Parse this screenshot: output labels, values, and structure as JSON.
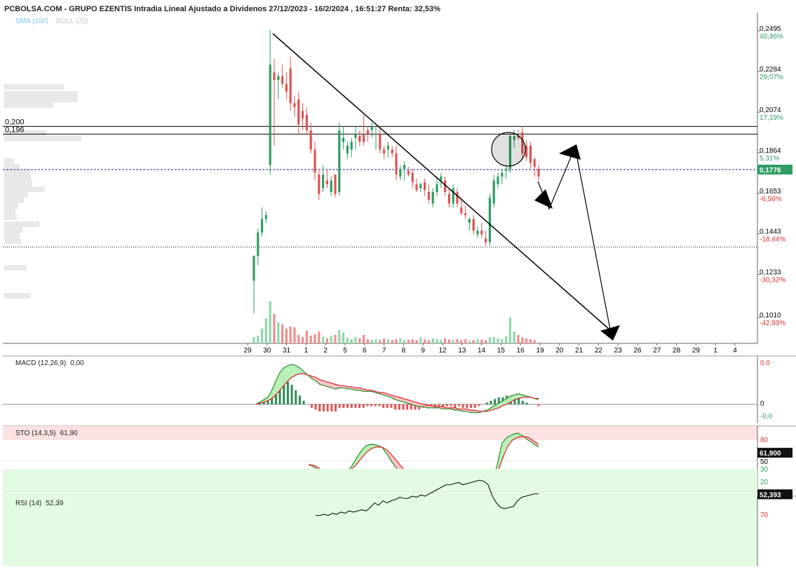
{
  "header": {
    "title": "PCBOLSA.COM - GRUPO EZENTIS Intradia Lineal Ajustado a Dividenos 27/12/2023 - 16/2/2024 , 16:51:27 Renta: 32,53%",
    "indicators_legend": [
      "SMA (100)",
      "BOLL (20)"
    ]
  },
  "colors": {
    "up": "#2e9e64",
    "down": "#e05252",
    "up_volume": "#8fd7ad",
    "down_volume": "#ef8d8d",
    "price_tag_bg": "#2e9e64",
    "axis_red": "#e03030",
    "axis_green": "#2e9e64",
    "overbought_zone": "#fde2e2",
    "oversold_zone": "#e2fbe2",
    "macd_fill_up": "#b9f0b9",
    "macd_fill_down": "#f7c5c5",
    "trendline": "#000000",
    "current_line": "#2222aa"
  },
  "chart_data": [
    {
      "type": "candlestick",
      "title": "PCBOLSA.COM - GRUPO EZENTIS Intradia Lineal Ajustado a Dividenos 27/12/2023 - 16/2/2024 , 16:51:27 Renta: 32,53%",
      "x_ticks": [
        "29",
        "30",
        "31",
        "1",
        "2",
        "5",
        "6",
        "7",
        "8",
        "9",
        "12",
        "13",
        "14",
        "15",
        "16",
        "19",
        "20",
        "21",
        "22",
        "23",
        "26",
        "27",
        "28",
        "29",
        "1",
        "4"
      ],
      "y_ticks": [
        {
          "value": 0.2495,
          "label": "0,2495",
          "pct": "40,96%"
        },
        {
          "value": 0.2284,
          "label": "0,2284",
          "pct": "29,07%"
        },
        {
          "value": 0.2074,
          "label": "0,2074",
          "pct": "17,19%"
        },
        {
          "value": 0.1864,
          "label": "0,1864",
          "pct": "5,31%"
        },
        {
          "value": 0.1653,
          "label": "0,1653",
          "pct": "-6,56%"
        },
        {
          "value": 0.1443,
          "label": "0,1443",
          "pct": "-18,44%"
        },
        {
          "value": 0.1233,
          "label": "0,1233",
          "pct": "-30,32%"
        },
        {
          "value": 0.101,
          "label": "0,1010",
          "pct": "-42,93%"
        }
      ],
      "last_price": {
        "value": 0.1776,
        "label": "0,1776"
      },
      "levels": [
        {
          "value": 0.2,
          "label": "0,200"
        },
        {
          "value": 0.196,
          "label": "0,196"
        },
        {
          "value": 0.1375,
          "label": ""
        }
      ],
      "candles": [
        {
          "o": 0.12,
          "h": 0.133,
          "l": 0.103,
          "c": 0.133
        },
        {
          "o": 0.133,
          "h": 0.147,
          "l": 0.128,
          "c": 0.145
        },
        {
          "o": 0.145,
          "h": 0.158,
          "l": 0.143,
          "c": 0.152
        },
        {
          "o": 0.152,
          "h": 0.156,
          "l": 0.15,
          "c": 0.154
        },
        {
          "o": 0.18,
          "h": 0.25,
          "l": 0.175,
          "c": 0.232
        },
        {
          "o": 0.228,
          "h": 0.235,
          "l": 0.19,
          "c": 0.224
        },
        {
          "o": 0.224,
          "h": 0.228,
          "l": 0.214,
          "c": 0.226
        },
        {
          "o": 0.226,
          "h": 0.232,
          "l": 0.22,
          "c": 0.222
        },
        {
          "o": 0.222,
          "h": 0.228,
          "l": 0.214,
          "c": 0.218
        },
        {
          "o": 0.23,
          "h": 0.236,
          "l": 0.208,
          "c": 0.212
        },
        {
          "o": 0.212,
          "h": 0.216,
          "l": 0.205,
          "c": 0.21
        },
        {
          "o": 0.214,
          "h": 0.218,
          "l": 0.196,
          "c": 0.201
        },
        {
          "o": 0.208,
          "h": 0.212,
          "l": 0.198,
          "c": 0.204
        },
        {
          "o": 0.206,
          "h": 0.21,
          "l": 0.196,
          "c": 0.198
        },
        {
          "o": 0.198,
          "h": 0.202,
          "l": 0.186,
          "c": 0.188
        },
        {
          "o": 0.188,
          "h": 0.192,
          "l": 0.172,
          "c": 0.176
        },
        {
          "o": 0.175,
          "h": 0.178,
          "l": 0.162,
          "c": 0.165
        },
        {
          "o": 0.168,
          "h": 0.18,
          "l": 0.166,
          "c": 0.175
        },
        {
          "o": 0.172,
          "h": 0.178,
          "l": 0.168,
          "c": 0.17
        },
        {
          "o": 0.166,
          "h": 0.174,
          "l": 0.164,
          "c": 0.172
        },
        {
          "o": 0.175,
          "h": 0.173,
          "l": 0.163,
          "c": 0.165
        },
        {
          "o": 0.166,
          "h": 0.202,
          "l": 0.164,
          "c": 0.198
        },
        {
          "o": 0.192,
          "h": 0.2,
          "l": 0.188,
          "c": 0.194
        },
        {
          "o": 0.186,
          "h": 0.192,
          "l": 0.183,
          "c": 0.19
        },
        {
          "o": 0.188,
          "h": 0.194,
          "l": 0.184,
          "c": 0.192
        },
        {
          "o": 0.194,
          "h": 0.2,
          "l": 0.188,
          "c": 0.196
        },
        {
          "o": 0.195,
          "h": 0.198,
          "l": 0.19,
          "c": 0.192
        },
        {
          "o": 0.196,
          "h": 0.206,
          "l": 0.19,
          "c": 0.192
        },
        {
          "o": 0.198,
          "h": 0.2,
          "l": 0.192,
          "c": 0.196
        },
        {
          "o": 0.198,
          "h": 0.202,
          "l": 0.194,
          "c": 0.2
        },
        {
          "o": 0.196,
          "h": 0.2,
          "l": 0.188,
          "c": 0.196
        },
        {
          "o": 0.196,
          "h": 0.2,
          "l": 0.186,
          "c": 0.188
        },
        {
          "o": 0.188,
          "h": 0.19,
          "l": 0.183,
          "c": 0.186
        },
        {
          "o": 0.188,
          "h": 0.192,
          "l": 0.184,
          "c": 0.19
        },
        {
          "o": 0.188,
          "h": 0.19,
          "l": 0.184,
          "c": 0.186
        },
        {
          "o": 0.186,
          "h": 0.19,
          "l": 0.172,
          "c": 0.175
        },
        {
          "o": 0.174,
          "h": 0.18,
          "l": 0.172,
          "c": 0.178
        },
        {
          "o": 0.178,
          "h": 0.182,
          "l": 0.172,
          "c": 0.18
        },
        {
          "o": 0.177,
          "h": 0.179,
          "l": 0.174,
          "c": 0.175
        },
        {
          "o": 0.176,
          "h": 0.178,
          "l": 0.168,
          "c": 0.171
        },
        {
          "o": 0.17,
          "h": 0.173,
          "l": 0.166,
          "c": 0.167
        },
        {
          "o": 0.168,
          "h": 0.171,
          "l": 0.166,
          "c": 0.17
        },
        {
          "o": 0.171,
          "h": 0.173,
          "l": 0.164,
          "c": 0.167
        },
        {
          "o": 0.166,
          "h": 0.17,
          "l": 0.16,
          "c": 0.162
        },
        {
          "o": 0.16,
          "h": 0.168,
          "l": 0.158,
          "c": 0.166
        },
        {
          "o": 0.166,
          "h": 0.174,
          "l": 0.164,
          "c": 0.17
        },
        {
          "o": 0.172,
          "h": 0.176,
          "l": 0.168,
          "c": 0.174
        },
        {
          "o": 0.172,
          "h": 0.174,
          "l": 0.164,
          "c": 0.166
        },
        {
          "o": 0.165,
          "h": 0.168,
          "l": 0.158,
          "c": 0.16
        },
        {
          "o": 0.16,
          "h": 0.17,
          "l": 0.158,
          "c": 0.168
        },
        {
          "o": 0.166,
          "h": 0.168,
          "l": 0.158,
          "c": 0.16
        },
        {
          "o": 0.158,
          "h": 0.163,
          "l": 0.154,
          "c": 0.155
        },
        {
          "o": 0.155,
          "h": 0.159,
          "l": 0.152,
          "c": 0.154
        },
        {
          "o": 0.15,
          "h": 0.153,
          "l": 0.146,
          "c": 0.152
        },
        {
          "o": 0.152,
          "h": 0.154,
          "l": 0.144,
          "c": 0.146
        },
        {
          "o": 0.144,
          "h": 0.148,
          "l": 0.142,
          "c": 0.146
        },
        {
          "o": 0.146,
          "h": 0.15,
          "l": 0.142,
          "c": 0.144
        },
        {
          "o": 0.142,
          "h": 0.146,
          "l": 0.138,
          "c": 0.14
        },
        {
          "o": 0.14,
          "h": 0.165,
          "l": 0.138,
          "c": 0.163
        },
        {
          "o": 0.16,
          "h": 0.175,
          "l": 0.158,
          "c": 0.172
        },
        {
          "o": 0.17,
          "h": 0.176,
          "l": 0.168,
          "c": 0.174
        },
        {
          "o": 0.174,
          "h": 0.178,
          "l": 0.17,
          "c": 0.176
        },
        {
          "o": 0.177,
          "h": 0.18,
          "l": 0.173,
          "c": 0.178
        },
        {
          "o": 0.178,
          "h": 0.196,
          "l": 0.176,
          "c": 0.195
        },
        {
          "o": 0.193,
          "h": 0.198,
          "l": 0.189,
          "c": 0.195
        },
        {
          "o": 0.195,
          "h": 0.198,
          "l": 0.193,
          "c": 0.194
        },
        {
          "o": 0.197,
          "h": 0.2,
          "l": 0.183,
          "c": 0.186
        },
        {
          "o": 0.19,
          "h": 0.193,
          "l": 0.182,
          "c": 0.184
        },
        {
          "o": 0.19,
          "h": 0.192,
          "l": 0.178,
          "c": 0.181
        },
        {
          "o": 0.183,
          "h": 0.184,
          "l": 0.174,
          "c": 0.179
        },
        {
          "o": 0.178,
          "h": 0.18,
          "l": 0.172,
          "c": 0.174
        }
      ],
      "volume": [
        0.15,
        0.18,
        0.35,
        0.6,
        1.0,
        0.7,
        0.5,
        0.45,
        0.35,
        0.4,
        0.38,
        0.2,
        0.15,
        0.3,
        0.18,
        0.22,
        0.28,
        0.16,
        0.12,
        0.18,
        0.2,
        0.32,
        0.26,
        0.14,
        0.1,
        0.15,
        0.12,
        0.2,
        0.1,
        0.09,
        0.1,
        0.08,
        0.12,
        0.1,
        0.08,
        0.1,
        0.12,
        0.08,
        0.09,
        0.1,
        0.08,
        0.14,
        0.1,
        0.08,
        0.12,
        0.1,
        0.08,
        0.12,
        0.09,
        0.08,
        0.1,
        0.08,
        0.1,
        0.07,
        0.08,
        0.1,
        0.09,
        0.08,
        0.14,
        0.15,
        0.12,
        0.1,
        0.16,
        0.62,
        0.28,
        0.2,
        0.14,
        0.12,
        0.1,
        0.08
      ]
    },
    {
      "type": "line",
      "title": "MACD (12,26,9)",
      "value_label": "0,00",
      "y_ticks": [
        {
          "value": 0.03,
          "label": "0,0"
        },
        {
          "value": 0.0,
          "label": "0"
        },
        {
          "value": -0.01,
          "label": "-0,0"
        }
      ],
      "macd": [
        0.0,
        0.002,
        0.004,
        0.006,
        0.012,
        0.02,
        0.027,
        0.031,
        0.033,
        0.034,
        0.033,
        0.031,
        0.028,
        0.025,
        0.022,
        0.02,
        0.017,
        0.016,
        0.015,
        0.014,
        0.013,
        0.014,
        0.014,
        0.013,
        0.013,
        0.012,
        0.012,
        0.011,
        0.011,
        0.011,
        0.01,
        0.009,
        0.008,
        0.007,
        0.006,
        0.004,
        0.003,
        0.002,
        0.001,
        0.0,
        -0.001,
        -0.002,
        -0.002,
        -0.003,
        -0.003,
        -0.003,
        -0.003,
        -0.004,
        -0.004,
        -0.004,
        -0.005,
        -0.005,
        -0.006,
        -0.006,
        -0.007,
        -0.007,
        -0.007,
        -0.006,
        -0.005,
        -0.003,
        -0.001,
        0.001,
        0.003,
        0.005,
        0.007,
        0.008,
        0.009,
        0.008,
        0.007,
        0.006,
        0.005,
        0.004
      ],
      "signal": [
        0.0,
        0.001,
        0.002,
        0.003,
        0.005,
        0.008,
        0.012,
        0.016,
        0.02,
        0.023,
        0.025,
        0.026,
        0.026,
        0.025,
        0.024,
        0.023,
        0.021,
        0.02,
        0.019,
        0.018,
        0.017,
        0.016,
        0.016,
        0.015,
        0.015,
        0.014,
        0.014,
        0.013,
        0.012,
        0.012,
        0.011,
        0.01,
        0.01,
        0.009,
        0.008,
        0.007,
        0.006,
        0.005,
        0.004,
        0.003,
        0.002,
        0.001,
        0.0,
        -0.001,
        -0.001,
        -0.002,
        -0.002,
        -0.002,
        -0.003,
        -0.003,
        -0.003,
        -0.004,
        -0.004,
        -0.004,
        -0.005,
        -0.005,
        -0.006,
        -0.006,
        -0.006,
        -0.005,
        -0.004,
        -0.003,
        -0.001,
        0.0,
        0.002,
        0.004,
        0.005,
        0.006,
        0.006,
        0.006,
        0.005,
        0.005
      ],
      "histogram": [
        0.0,
        0.001,
        0.002,
        0.003,
        0.007,
        0.012,
        0.015,
        0.015,
        0.013,
        0.011,
        0.008,
        0.005,
        0.002,
        0.0,
        -0.002,
        -0.003,
        -0.004,
        -0.004,
        -0.004,
        -0.004,
        -0.004,
        -0.002,
        -0.002,
        -0.002,
        -0.002,
        -0.002,
        -0.002,
        -0.002,
        -0.001,
        -0.001,
        -0.001,
        -0.001,
        -0.002,
        -0.002,
        -0.002,
        -0.003,
        -0.003,
        -0.003,
        -0.003,
        -0.003,
        -0.003,
        -0.003,
        -0.002,
        -0.002,
        -0.002,
        -0.001,
        -0.001,
        -0.002,
        -0.001,
        -0.001,
        -0.002,
        -0.001,
        -0.002,
        -0.002,
        -0.002,
        -0.002,
        -0.001,
        0.0,
        0.001,
        0.002,
        0.003,
        0.004,
        0.004,
        0.005,
        0.005,
        0.004,
        0.004,
        0.002,
        0.001,
        0.0,
        0.0,
        -0.001
      ]
    },
    {
      "type": "line",
      "title": "STO (14,3,5)",
      "value_label": "61,90",
      "last_value": {
        "value": 61.9,
        "label": "61,900"
      },
      "y_ticks": [
        {
          "value": 80,
          "label": "80"
        },
        {
          "value": 50,
          "label": "50"
        },
        {
          "value": 20,
          "label": "20"
        }
      ],
      "k": [
        45,
        42,
        36,
        24,
        22,
        34,
        35,
        36,
        40,
        52,
        64,
        72,
        74,
        73,
        70,
        60,
        48,
        38,
        28,
        24,
        22,
        22,
        21,
        24,
        34,
        32,
        35,
        30,
        32,
        28,
        23,
        20,
        20,
        22,
        23,
        23,
        42,
        76,
        84,
        88,
        90,
        86,
        80,
        75,
        70
      ],
      "d": [
        45,
        44,
        40,
        33,
        28,
        32,
        33,
        35,
        37,
        44,
        53,
        62,
        68,
        70,
        70,
        66,
        58,
        49,
        40,
        33,
        28,
        24,
        22,
        22,
        26,
        28,
        30,
        31,
        31,
        29,
        27,
        24,
        22,
        21,
        21,
        22,
        30,
        52,
        70,
        80,
        84,
        85,
        84,
        79,
        74
      ]
    },
    {
      "type": "line",
      "title": "RSI (14)",
      "value_label": "52,39",
      "last_value": {
        "value": 52.39,
        "label": "52,393"
      },
      "y_ticks": [
        {
          "value": 70,
          "label": "70"
        },
        {
          "value": 30,
          "label": "30"
        }
      ],
      "values": [
        71,
        71,
        70,
        71,
        69,
        70,
        68,
        69,
        67,
        68,
        67,
        66,
        67,
        64,
        60,
        62,
        58,
        60,
        58,
        57,
        55,
        56,
        56,
        54,
        55,
        53,
        54,
        52,
        50,
        48,
        46,
        44,
        44,
        43,
        42,
        44,
        43,
        42,
        41,
        40,
        41,
        44,
        54,
        60,
        64,
        65,
        64,
        63,
        58,
        55,
        54,
        53,
        52,
        52
      ]
    }
  ]
}
